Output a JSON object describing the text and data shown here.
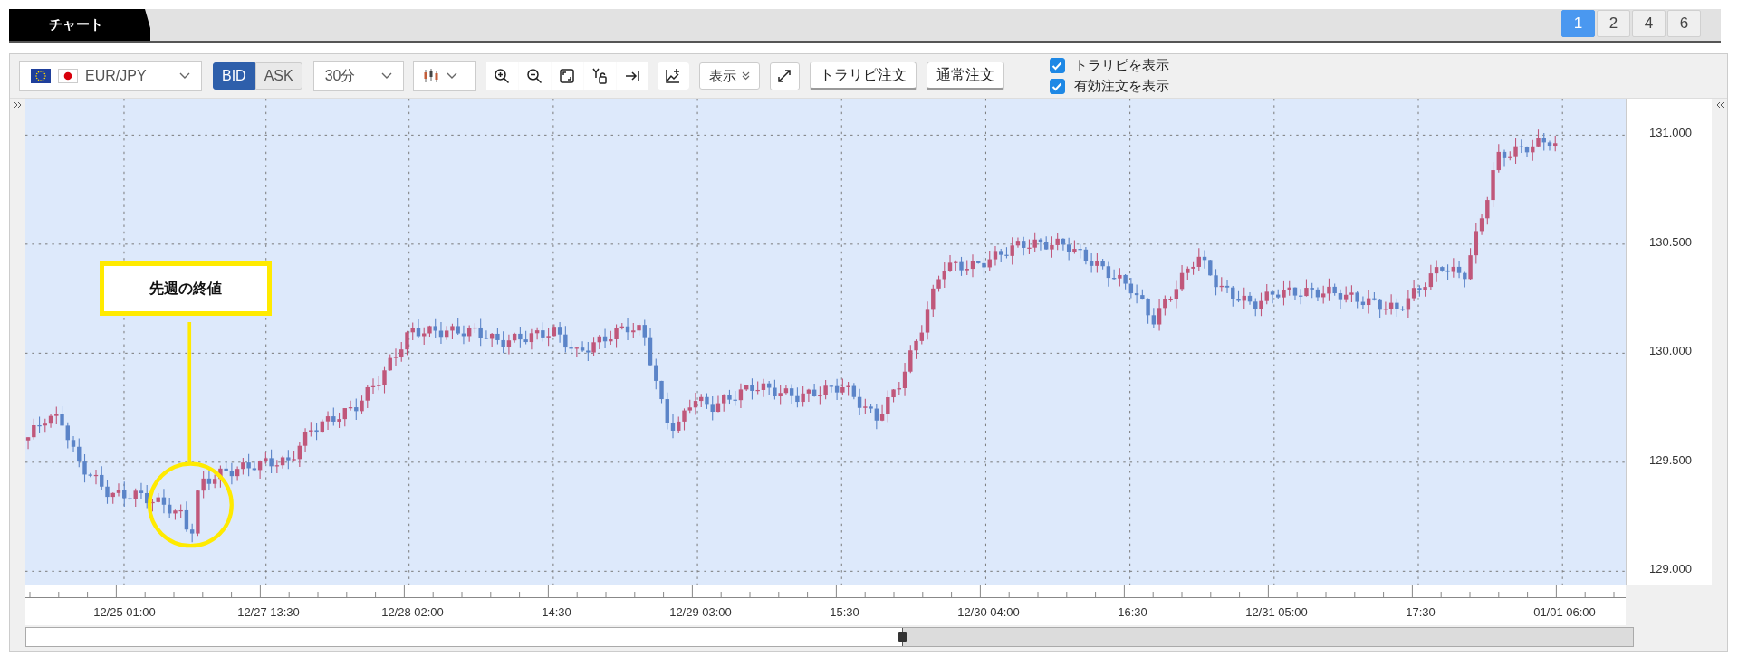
{
  "top_tab": {
    "label": "チャート"
  },
  "layout_buttons": [
    {
      "label": "1",
      "selected": true
    },
    {
      "label": "2",
      "selected": false
    },
    {
      "label": "4",
      "selected": false
    },
    {
      "label": "6",
      "selected": false
    }
  ],
  "toolbar": {
    "pair": {
      "value": "EUR/JPY"
    },
    "price_side": [
      {
        "label": "BID",
        "selected": true
      },
      {
        "label": "ASK",
        "selected": false
      }
    ],
    "interval": {
      "value": "30分"
    },
    "display_menu": {
      "label": "表示"
    },
    "order_buttons": [
      {
        "label": "トラリピ注文"
      },
      {
        "label": "通常注文"
      }
    ],
    "checkboxes": [
      {
        "label": "トラリピを表示",
        "checked": true
      },
      {
        "label": "有効注文を表示",
        "checked": true
      }
    ]
  },
  "chart": {
    "callout": "先週の終値",
    "y_axis": [
      "131.000",
      "130.500",
      "130.000",
      "129.500",
      "129.000"
    ],
    "x_axis": [
      "12/25 01:00",
      "12/27 13:30",
      "12/28 02:00",
      "14:30",
      "12/29 03:00",
      "15:30",
      "12/30 04:00",
      "16:30",
      "12/31 05:00",
      "17:30",
      "01/01 06:00"
    ]
  }
}
